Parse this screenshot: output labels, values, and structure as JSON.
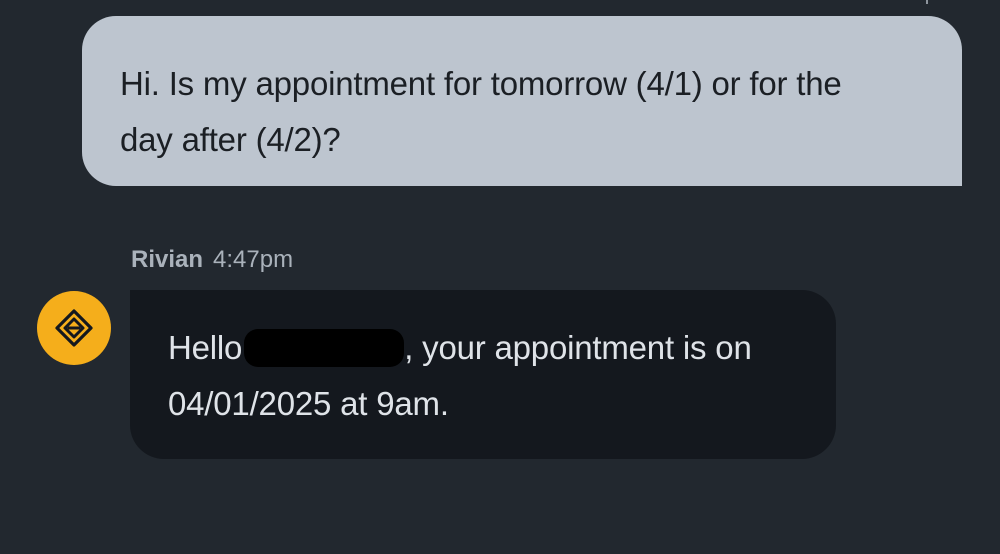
{
  "conversation": {
    "user_message": {
      "line1": "Hi. Is my appointment for tomorrow (4/1) or for the",
      "line2": "day after (4/2)?"
    },
    "agent_message": {
      "sender": "Rivian",
      "time": "4:47pm",
      "greeting": "Hello",
      "line1_rest": ", your appointment is on",
      "line2": "04/01/2025 at 9am."
    }
  },
  "avatar": {
    "icon": "rivian-logo-icon",
    "color": "#f5ae1b"
  },
  "colors": {
    "background": "#22282f",
    "user_bubble": "#bdc5cf",
    "agent_bubble": "#14181e"
  }
}
